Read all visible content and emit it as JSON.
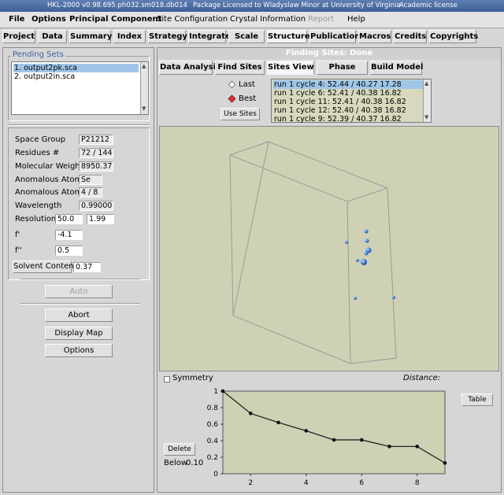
{
  "titlebar": {
    "app": "HKL-2000 v0.98.695.ph032.sm018.db014",
    "license": "Package Licensed to Wladyslaw Minor at University of Virginia",
    "type": "Academic license"
  },
  "menu": {
    "file": "File",
    "options": "Options",
    "principal_component": "Principal Component",
    "site_configuration": "Site Configuration",
    "crystal_information": "Crystal Information",
    "report": "Report",
    "help": "Help"
  },
  "main_tabs": [
    "Project",
    "Data",
    "Summary",
    "Index",
    "Strategy",
    "Integrate",
    "Scale",
    "Structure",
    "Publication",
    "Macros",
    "Credits",
    "Copyrights"
  ],
  "pending_sets": {
    "title": "Pending Sets",
    "items": [
      "1. output2pk.sca",
      "2. output2in.sca"
    ]
  },
  "fields": {
    "space_group": {
      "label": "Space Group",
      "value": "P21212"
    },
    "residues": {
      "label": "Residues #",
      "value": "72 / 144"
    },
    "molecular_weight": {
      "label": "Molecular Weight",
      "value": "8950.37"
    },
    "anomalous_atom": {
      "label": "Anomalous Atom",
      "value": "Se"
    },
    "anomalous_atoms_count": {
      "label": "Anomalous Atoms #",
      "value": "4 / 8"
    },
    "wavelength": {
      "label": "Wavelength",
      "value": "0.99000"
    },
    "resolution": {
      "label": "Resolution",
      "low": "50.0",
      "high": "1.99"
    },
    "f_prime": {
      "label": "f'",
      "value": "-4.1"
    },
    "f_double_prime": {
      "label": "f''",
      "value": "0.5"
    },
    "solvent_content": {
      "label": "Solvent Content",
      "value": "0.37"
    }
  },
  "buttons": {
    "auto": "Auto",
    "abort": "Abort",
    "display_map": "Display Map",
    "options": "Options",
    "use_sites": "Use Sites",
    "delete": "Delete",
    "table": "Table"
  },
  "status": "Finding Sites: Done",
  "sub_tabs": [
    "Data Analysis",
    "Find Sites",
    "Sites View",
    "Phase",
    "Build Model"
  ],
  "active_sub_tab": "Sites View",
  "radio": {
    "last": "Last",
    "best": "Best",
    "selected": "best"
  },
  "runs": [
    "run 1 cycle 4:  52.44  /  40.27  17.28",
    "run 1 cycle 6:  52.41  /  40.38  16.82",
    "run 1 cycle 11:  52.41  /  40.38  16.82",
    "run 1 cycle 12:  52.40  /  40.38  16.82",
    "run 1 cycle 9:  52.39  /  40.37  16.82"
  ],
  "symmetry_label": "Symmetry",
  "distance_label": "Distance:",
  "below": {
    "label": "Below",
    "value": "0.10"
  },
  "colors": {
    "accent": "#3b5fa0",
    "selection": "#9fc6e8",
    "viewport": "#cfd1b4",
    "atom": "#3f7fd6"
  },
  "chart_data": {
    "type": "line",
    "x": [
      1,
      2,
      3,
      4,
      5,
      6,
      7,
      8,
      9
    ],
    "values": [
      1.0,
      0.73,
      0.62,
      0.52,
      0.41,
      0.41,
      0.33,
      0.33,
      0.13
    ],
    "xlim": [
      1,
      9
    ],
    "ylim": [
      0,
      1
    ],
    "xticks": [
      2,
      4,
      6,
      8
    ],
    "yticks": [
      0,
      0.2,
      0.4,
      0.6,
      0.8,
      1
    ],
    "title": "",
    "xlabel": "",
    "ylabel": "",
    "grid": false
  }
}
